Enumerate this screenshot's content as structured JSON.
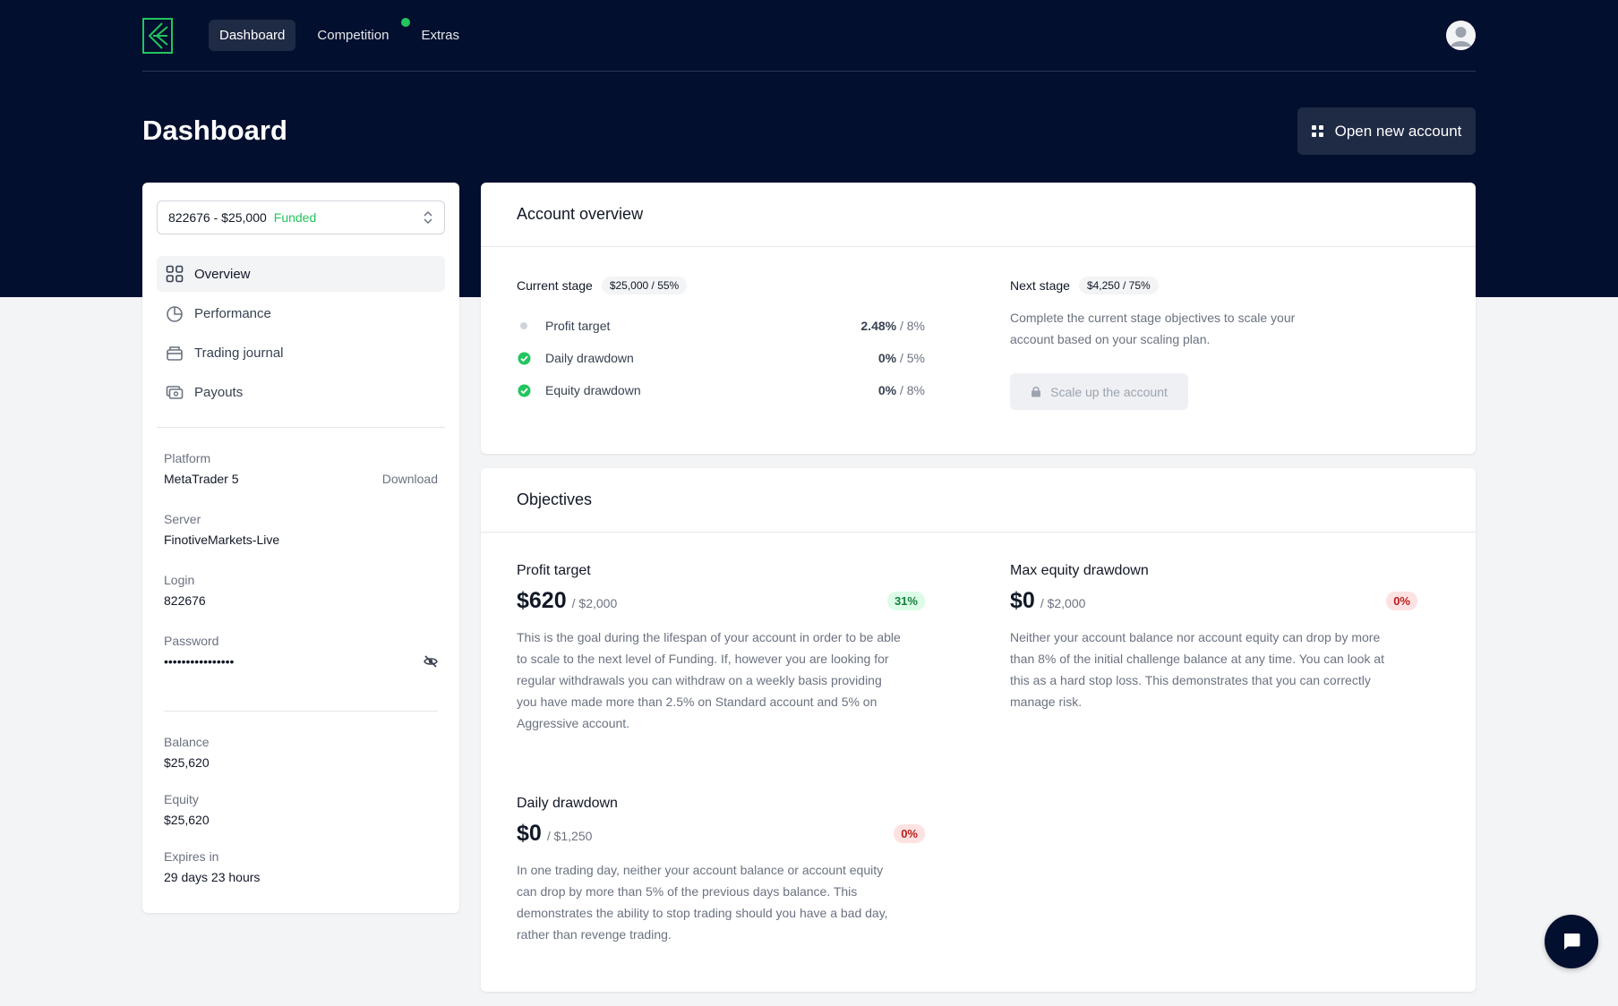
{
  "nav": {
    "items": [
      {
        "label": "Dashboard"
      },
      {
        "label": "Competition"
      },
      {
        "label": "Extras"
      }
    ]
  },
  "page": {
    "title": "Dashboard",
    "open_account_label": "Open new account"
  },
  "account_select": {
    "value": "822676 - $25,000",
    "status": "Funded"
  },
  "menu": {
    "items": [
      {
        "label": "Overview",
        "icon": "grid-icon"
      },
      {
        "label": "Performance",
        "icon": "pie-chart-icon"
      },
      {
        "label": "Trading journal",
        "icon": "journal-icon"
      },
      {
        "label": "Payouts",
        "icon": "cash-icon"
      }
    ]
  },
  "details": {
    "platform_label": "Platform",
    "platform_value": "MetaTrader 5",
    "download_label": "Download",
    "server_label": "Server",
    "server_value": "FinotiveMarkets-Live",
    "login_label": "Login",
    "login_value": "822676",
    "password_label": "Password",
    "password_value": "••••••••••••••••",
    "balance_label": "Balance",
    "balance_value": "$25,620",
    "equity_label": "Equity",
    "equity_value": "$25,620",
    "expires_label": "Expires in",
    "expires_value": "29 days 23 hours"
  },
  "overview": {
    "title": "Account overview",
    "current_stage_label": "Current stage",
    "current_stage_pill": "$25,000 / 55%",
    "objectives": [
      {
        "label": "Profit target",
        "value": "2.48%",
        "limit": " / 8%",
        "done": false
      },
      {
        "label": "Daily drawdown",
        "value": "0%",
        "limit": " / 5%",
        "done": true
      },
      {
        "label": "Equity drawdown",
        "value": "0%",
        "limit": " / 8%",
        "done": true
      }
    ],
    "next_stage_label": "Next stage",
    "next_stage_pill": "$4,250 / 75%",
    "next_stage_desc": "Complete the current stage objectives to scale your account based on your scaling plan.",
    "scale_button_label": "Scale up the account"
  },
  "objectives": {
    "title": "Objectives",
    "profit": {
      "name": "Profit target",
      "amount": "$620",
      "of": "/ $2,000",
      "percent": "31%",
      "desc": "This is the goal during the lifespan of your account in order to be able to scale to the next level of Funding. If, however you are looking for regular withdrawals you can withdraw on a weekly basis providing you have made more than 2.5% on Standard account and 5% on Aggressive account."
    },
    "equity": {
      "name": "Max equity drawdown",
      "amount": "$0",
      "of": "/ $2,000",
      "percent": "0%",
      "desc": "Neither your account balance nor account equity can drop by more than 8% of the initial challenge balance at any time. You can look at this as a hard stop loss. This demonstrates that you can correctly manage risk."
    },
    "daily": {
      "name": "Daily drawdown",
      "amount": "$0",
      "of": "/ $1,250",
      "percent": "0%",
      "desc": "In one trading day, neither your account balance or account equity can drop by more than 5% of the previous days balance. This demonstrates the ability to stop trading should you have a bad day, rather than revenge trading."
    }
  },
  "colors": {
    "hero_bg": "#030f2e",
    "accent_green": "#22c55e",
    "danger_red": "#b91c1c"
  }
}
